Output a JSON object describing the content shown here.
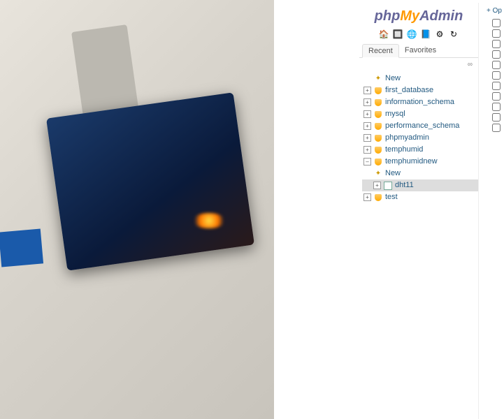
{
  "logo": {
    "part1": "php",
    "part2": "My",
    "part3": "Admin"
  },
  "tabs": {
    "recent": "Recent",
    "favorites": "Favorites"
  },
  "infinity": "∞",
  "op": "+ Op",
  "tree": {
    "new": "New",
    "items": [
      "first_database",
      "information_schema",
      "mysql",
      "performance_schema",
      "phpmyadmin",
      "temphumid"
    ],
    "expanded": {
      "name": "temphumidnew",
      "children": {
        "new": "New",
        "table": "dht11"
      }
    },
    "last": "test"
  }
}
